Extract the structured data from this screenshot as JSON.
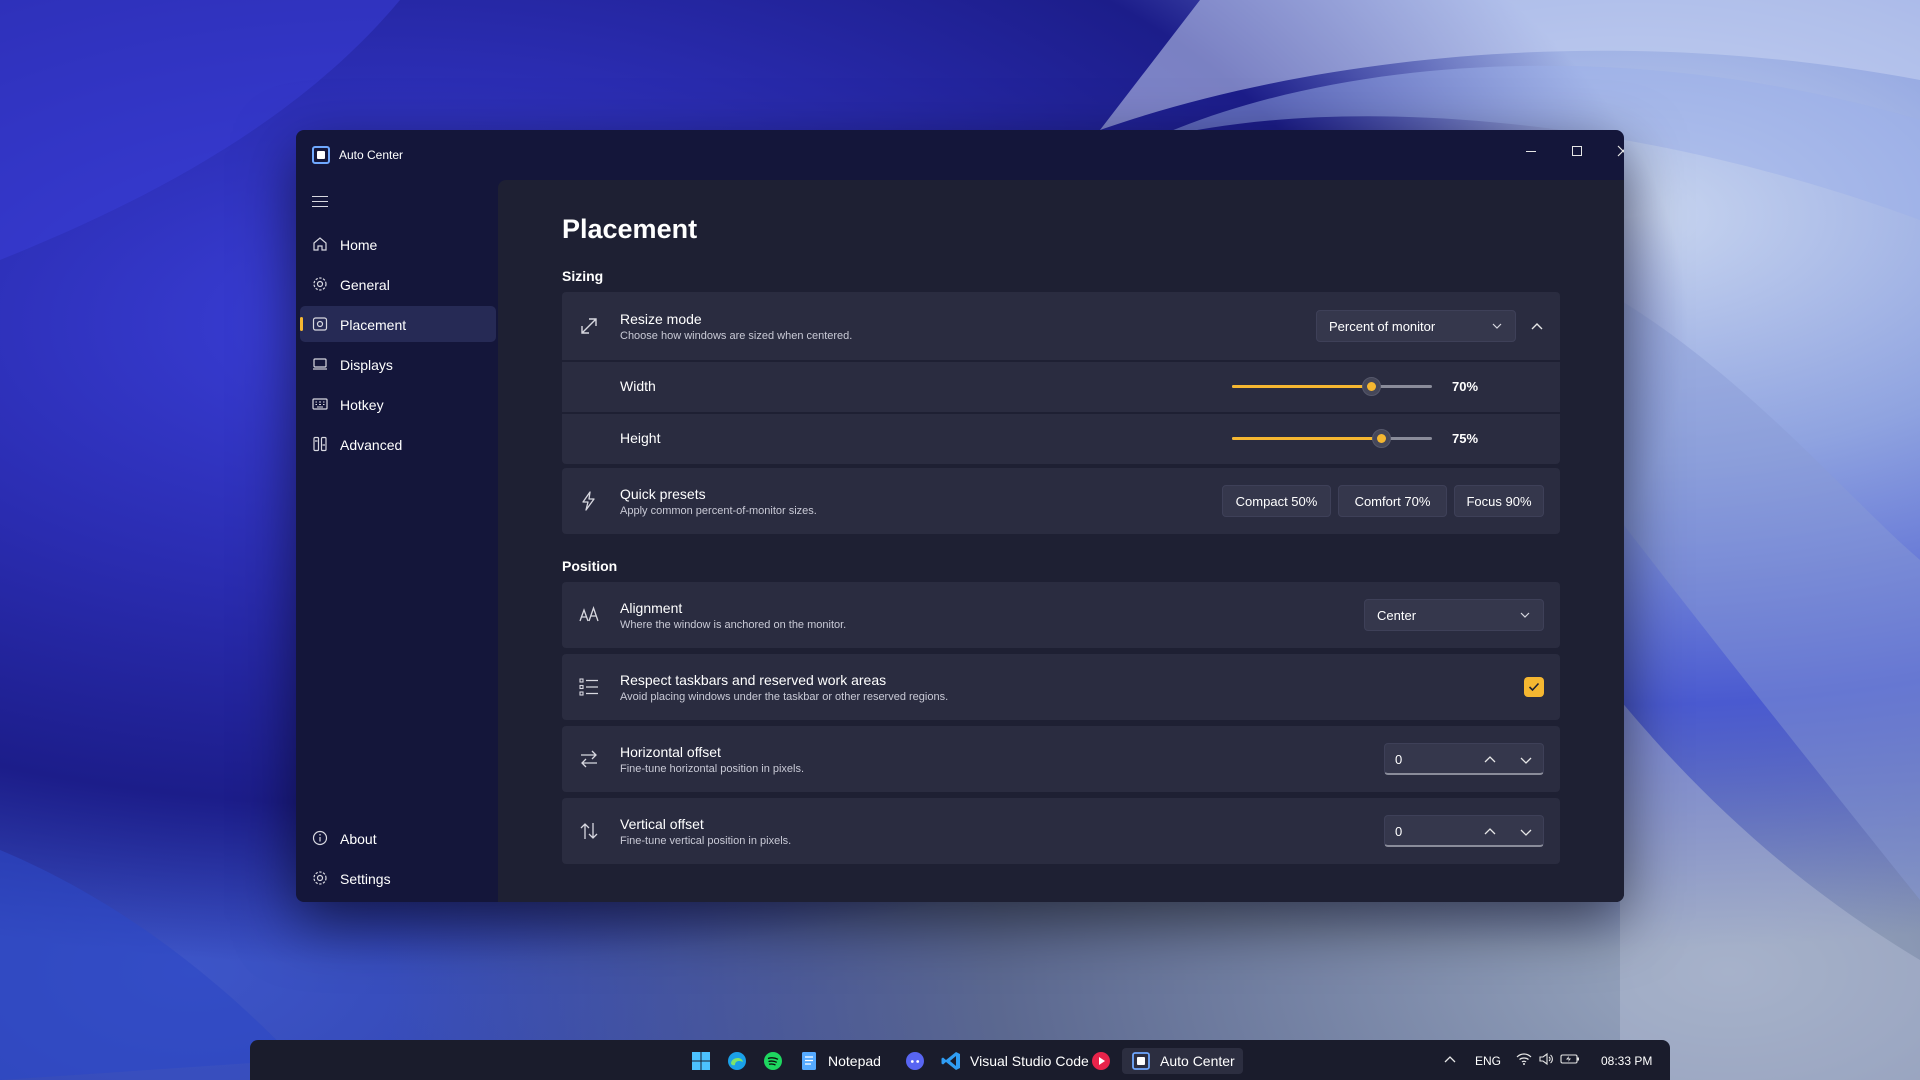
{
  "window": {
    "title": "Auto Center"
  },
  "sidebar": {
    "items": [
      {
        "label": "Home",
        "icon": "home-icon"
      },
      {
        "label": "General",
        "icon": "gear-icon"
      },
      {
        "label": "Placement",
        "icon": "placement-icon",
        "active": true
      },
      {
        "label": "Displays",
        "icon": "display-icon"
      },
      {
        "label": "Hotkey",
        "icon": "keyboard-icon"
      },
      {
        "label": "Advanced",
        "icon": "advanced-icon"
      }
    ],
    "footer": [
      {
        "label": "About",
        "icon": "info-icon"
      },
      {
        "label": "Settings",
        "icon": "gear-icon"
      }
    ]
  },
  "page": {
    "title": "Placement",
    "sizing": {
      "heading": "Sizing",
      "resize_mode": {
        "title": "Resize mode",
        "description": "Choose how windows are sized when centered.",
        "value": "Percent of monitor"
      },
      "width": {
        "label": "Width",
        "value": "70%",
        "fraction": 0.7
      },
      "height": {
        "label": "Height",
        "value": "75%",
        "fraction": 0.75
      },
      "presets": {
        "title": "Quick presets",
        "description": "Apply common percent-of-monitor sizes.",
        "buttons": [
          "Compact 50%",
          "Comfort 70%",
          "Focus 90%"
        ]
      }
    },
    "position": {
      "heading": "Position",
      "alignment": {
        "title": "Alignment",
        "description": "Where the window is anchored on the monitor.",
        "value": "Center"
      },
      "respect_taskbars": {
        "title": "Respect taskbars and reserved work areas",
        "description": "Avoid placing windows under the taskbar or other reserved regions.",
        "checked": true
      },
      "horizontal_offset": {
        "title": "Horizontal offset",
        "description": "Fine-tune horizontal position in pixels.",
        "value": "0"
      },
      "vertical_offset": {
        "title": "Vertical offset",
        "description": "Fine-tune vertical position in pixels.",
        "value": "0"
      }
    }
  },
  "taskbar": {
    "apps": [
      {
        "label": "",
        "icon": "windows-start-icon"
      },
      {
        "label": "",
        "icon": "edge-icon"
      },
      {
        "label": "",
        "icon": "spotify-icon"
      },
      {
        "label": "Notepad",
        "icon": "notepad-icon"
      },
      {
        "label": "",
        "icon": "discord-icon"
      },
      {
        "label": "Visual Studio Code",
        "icon": "vscode-icon"
      },
      {
        "label": "",
        "icon": "media-player-icon"
      },
      {
        "label": "Auto Center",
        "icon": "auto-center-icon",
        "active": true
      }
    ],
    "tray": {
      "language": "ENG",
      "time": "08:33 PM"
    }
  },
  "colors": {
    "accent": "#f5b731",
    "window_bg": "#14163a",
    "content_bg": "#1e2033",
    "card_bg": "#2a2c40"
  }
}
